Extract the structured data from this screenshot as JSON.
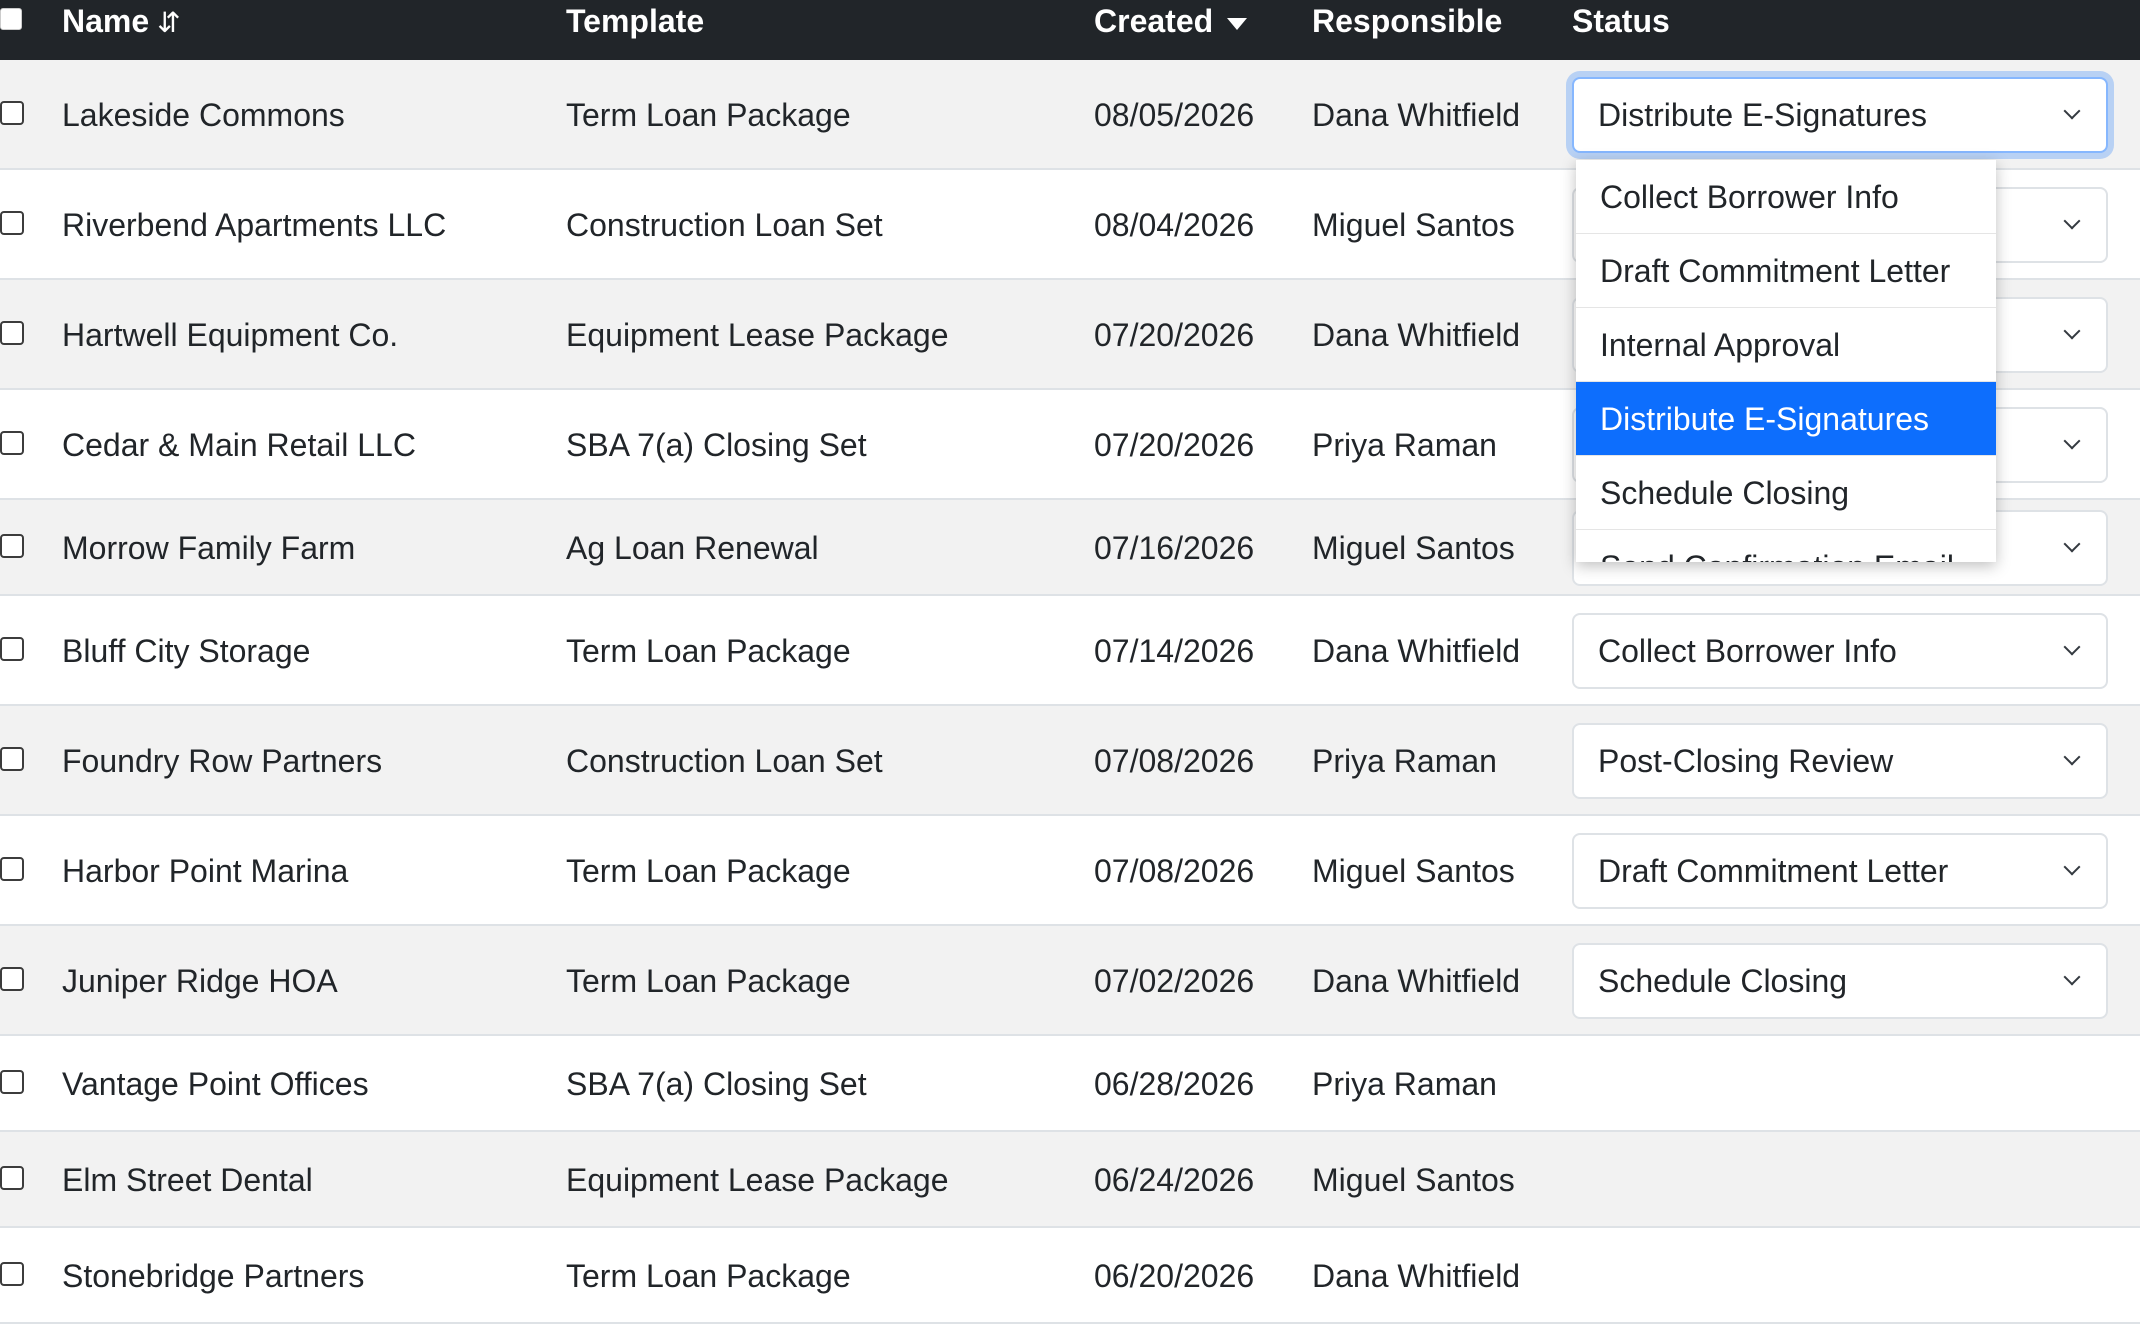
{
  "table": {
    "headers": {
      "name": "Name",
      "template": "Template",
      "created": "Created",
      "responsible": "Responsible",
      "status": "Status"
    },
    "rows": [
      {
        "name": "Lakeside Commons",
        "template": "Term Loan Package",
        "created": "08/05/2026",
        "responsible": "Dana Whitfield",
        "status": "Distribute E-Signatures"
      },
      {
        "name": "Riverbend Apartments LLC",
        "template": "Construction Loan Set",
        "created": "08/04/2026",
        "responsible": "Miguel Santos",
        "status": ""
      },
      {
        "name": "Hartwell Equipment Co.",
        "template": "Equipment Lease Package",
        "created": "07/20/2026",
        "responsible": "Dana Whitfield",
        "status": ""
      },
      {
        "name": "Cedar & Main Retail LLC",
        "template": "SBA 7(a) Closing Set",
        "created": "07/20/2026",
        "responsible": "Priya Raman",
        "status": ""
      },
      {
        "name": "Morrow Family Farm",
        "template": "Ag Loan Renewal",
        "created": "07/16/2026",
        "responsible": "Miguel Santos",
        "status": ""
      },
      {
        "name": "Bluff City Storage",
        "template": "Term Loan Package",
        "created": "07/14/2026",
        "responsible": "Dana Whitfield",
        "status": "Collect Borrower Info"
      },
      {
        "name": "Foundry Row Partners",
        "template": "Construction Loan Set",
        "created": "07/08/2026",
        "responsible": "Priya Raman",
        "status": "Post-Closing Review"
      },
      {
        "name": "Harbor Point Marina",
        "template": "Term Loan Package",
        "created": "07/08/2026",
        "responsible": "Miguel Santos",
        "status": "Draft Commitment Letter"
      },
      {
        "name": "Juniper Ridge HOA",
        "template": "Term Loan Package",
        "created": "07/02/2026",
        "responsible": "Dana Whitfield",
        "status": "Schedule Closing"
      },
      {
        "name": "Vantage Point Offices",
        "template": "SBA 7(a) Closing Set",
        "created": "06/28/2026",
        "responsible": "Priya Raman"
      },
      {
        "name": "Elm Street Dental",
        "template": "Equipment Lease Package",
        "created": "06/24/2026",
        "responsible": "Miguel Santos"
      },
      {
        "name": "Stonebridge Partners",
        "template": "Term Loan Package",
        "created": "06/20/2026",
        "responsible": "Dana Whitfield"
      }
    ]
  },
  "dropdown": {
    "options": [
      "Collect Borrower Info",
      "Draft Commitment Letter",
      "Internal Approval",
      "Distribute E-Signatures",
      "Schedule Closing",
      "Send Confirmation Email"
    ],
    "selected": "Distribute E-Signatures"
  },
  "icons": {
    "name_sort": "sort-arrows-icon",
    "created_sort": "caret-down-icon",
    "select_chevron": "chevron-down-icon"
  },
  "colors": {
    "header_bg": "#212529",
    "selected_option": "#0d6efd",
    "focus_ring": "#86b7fe",
    "stripe": "#f2f2f2"
  }
}
